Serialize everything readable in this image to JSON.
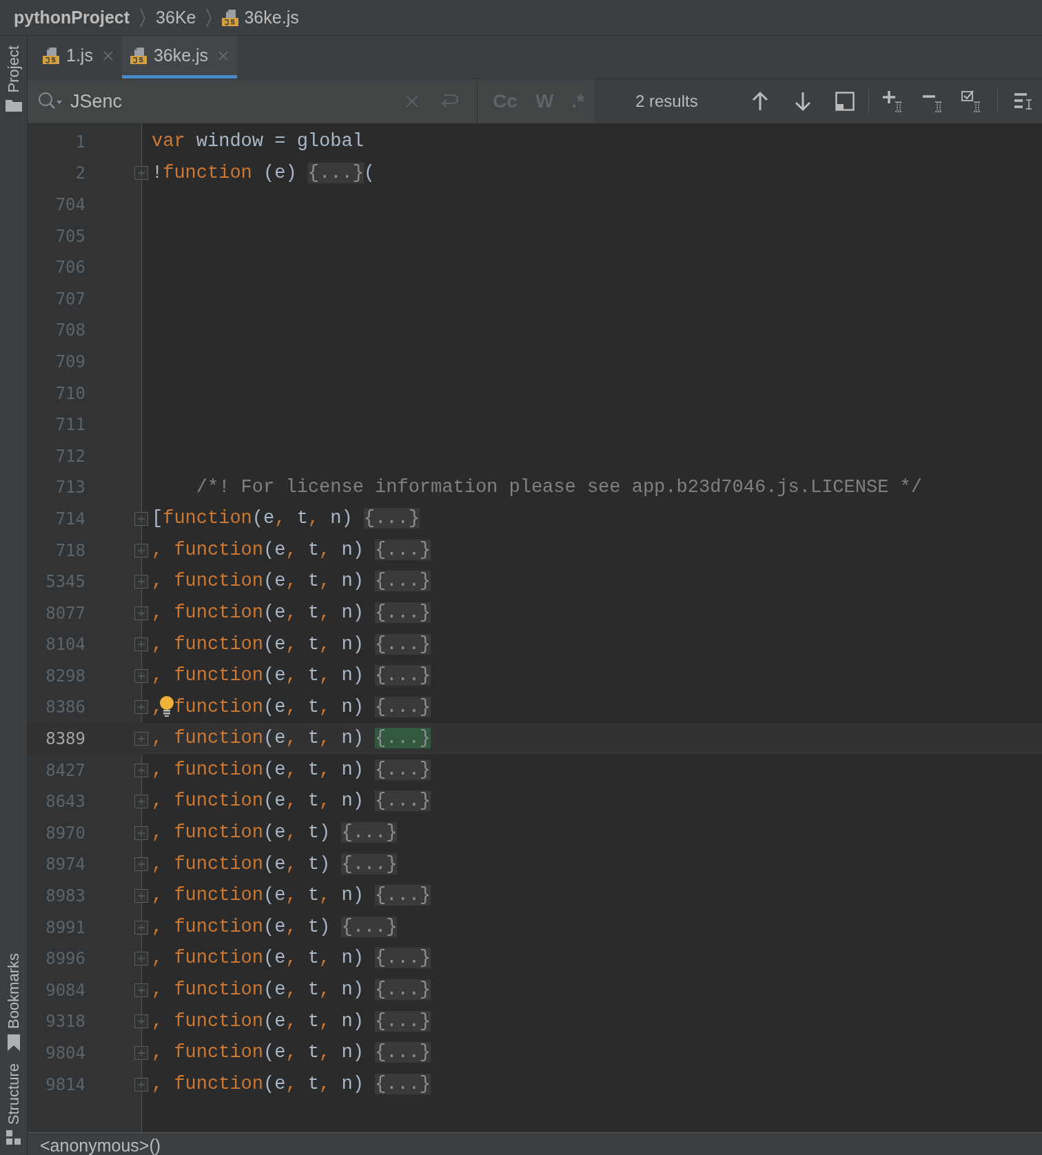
{
  "breadcrumb": [
    {
      "label": "pythonProject",
      "kind": "project"
    },
    {
      "label": "36Ke",
      "kind": "folder"
    },
    {
      "label": "36ke.js",
      "kind": "file"
    }
  ],
  "side_tools": [
    {
      "label": "Project",
      "kind": "folder"
    },
    {
      "label": "Bookmarks",
      "kind": "bookmark"
    },
    {
      "label": "Structure",
      "kind": "structure"
    }
  ],
  "tabs": [
    {
      "label": "1.js",
      "selected": false
    },
    {
      "label": "36ke.js",
      "selected": true
    }
  ],
  "search": {
    "value": "JSenc",
    "options": [
      "Cc",
      "W",
      ".*"
    ],
    "result_count": "2 results"
  },
  "lines": [
    {
      "number": "1",
      "current": false,
      "bulb": false,
      "foldable": false,
      "tokens": [
        {
          "kind": "keyword",
          "text": "var"
        },
        {
          "kind": "plain",
          "text": " window = global"
        }
      ]
    },
    {
      "number": "2",
      "current": false,
      "bulb": false,
      "foldable": true,
      "tokens": [
        {
          "kind": "plain",
          "text": "!"
        },
        {
          "kind": "keyword",
          "text": "function"
        },
        {
          "kind": "plain",
          "text": " (e) "
        },
        {
          "kind": "fold",
          "text": "{...}"
        },
        {
          "kind": "plain",
          "text": "("
        }
      ]
    },
    {
      "number": "704",
      "current": false,
      "bulb": false,
      "foldable": false
    },
    {
      "number": "705",
      "current": false,
      "bulb": false,
      "foldable": false
    },
    {
      "number": "706",
      "current": false,
      "bulb": false,
      "foldable": false
    },
    {
      "number": "707",
      "current": false,
      "bulb": false,
      "foldable": false
    },
    {
      "number": "708",
      "current": false,
      "bulb": false,
      "foldable": false
    },
    {
      "number": "709",
      "current": false,
      "bulb": false,
      "foldable": false
    },
    {
      "number": "710",
      "current": false,
      "bulb": false,
      "foldable": false
    },
    {
      "number": "711",
      "current": false,
      "bulb": false,
      "foldable": false
    },
    {
      "number": "712",
      "current": false,
      "bulb": false,
      "foldable": false
    },
    {
      "number": "713",
      "current": false,
      "bulb": false,
      "foldable": false,
      "tokens": [
        {
          "kind": "comment",
          "text": "    /*! For license information please see app.b23d7046.js.LICENSE */"
        }
      ]
    },
    {
      "number": "714",
      "current": false,
      "bulb": false,
      "foldable": true,
      "tokens": [
        {
          "kind": "plain",
          "text": "["
        },
        {
          "kind": "keyword",
          "text": "function"
        },
        {
          "kind": "plain",
          "text": "(e"
        },
        {
          "kind": "keyword",
          "text": ", "
        },
        {
          "kind": "plain",
          "text": "t"
        },
        {
          "kind": "keyword",
          "text": ", "
        },
        {
          "kind": "plain",
          "text": "n) "
        },
        {
          "kind": "fold",
          "text": "{...}"
        }
      ]
    },
    {
      "number": "718",
      "current": false,
      "bulb": false,
      "foldable": true,
      "tokens": [
        {
          "kind": "keyword",
          "text": ", function"
        },
        {
          "kind": "plain",
          "text": "(e"
        },
        {
          "kind": "keyword",
          "text": ", "
        },
        {
          "kind": "plain",
          "text": "t"
        },
        {
          "kind": "keyword",
          "text": ", "
        },
        {
          "kind": "plain",
          "text": "n) "
        },
        {
          "kind": "fold",
          "text": "{...}"
        }
      ]
    },
    {
      "number": "5345",
      "current": false,
      "bulb": false,
      "foldable": true,
      "tokens": [
        {
          "kind": "keyword",
          "text": ", function"
        },
        {
          "kind": "plain",
          "text": "(e"
        },
        {
          "kind": "keyword",
          "text": ", "
        },
        {
          "kind": "plain",
          "text": "t"
        },
        {
          "kind": "keyword",
          "text": ", "
        },
        {
          "kind": "plain",
          "text": "n) "
        },
        {
          "kind": "fold",
          "text": "{...}"
        }
      ]
    },
    {
      "number": "8077",
      "current": false,
      "bulb": false,
      "foldable": true,
      "tokens": [
        {
          "kind": "keyword",
          "text": ", function"
        },
        {
          "kind": "plain",
          "text": "(e"
        },
        {
          "kind": "keyword",
          "text": ", "
        },
        {
          "kind": "plain",
          "text": "t"
        },
        {
          "kind": "keyword",
          "text": ", "
        },
        {
          "kind": "plain",
          "text": "n) "
        },
        {
          "kind": "fold",
          "text": "{...}"
        }
      ]
    },
    {
      "number": "8104",
      "current": false,
      "bulb": false,
      "foldable": true,
      "tokens": [
        {
          "kind": "keyword",
          "text": ", function"
        },
        {
          "kind": "plain",
          "text": "(e"
        },
        {
          "kind": "keyword",
          "text": ", "
        },
        {
          "kind": "plain",
          "text": "t"
        },
        {
          "kind": "keyword",
          "text": ", "
        },
        {
          "kind": "plain",
          "text": "n) "
        },
        {
          "kind": "fold",
          "text": "{...}"
        }
      ]
    },
    {
      "number": "8298",
      "current": false,
      "bulb": false,
      "foldable": true,
      "tokens": [
        {
          "kind": "keyword",
          "text": ", function"
        },
        {
          "kind": "plain",
          "text": "(e"
        },
        {
          "kind": "keyword",
          "text": ", "
        },
        {
          "kind": "plain",
          "text": "t"
        },
        {
          "kind": "keyword",
          "text": ", "
        },
        {
          "kind": "plain",
          "text": "n) "
        },
        {
          "kind": "fold",
          "text": "{...}"
        }
      ]
    },
    {
      "number": "8386",
      "current": false,
      "bulb": true,
      "foldable": true,
      "tokens": [
        {
          "kind": "keyword",
          "text": ", function"
        },
        {
          "kind": "plain",
          "text": "(e"
        },
        {
          "kind": "keyword",
          "text": ", "
        },
        {
          "kind": "plain",
          "text": "t"
        },
        {
          "kind": "keyword",
          "text": ", "
        },
        {
          "kind": "plain",
          "text": "n) "
        },
        {
          "kind": "fold",
          "text": "{...}"
        }
      ]
    },
    {
      "number": "8389",
      "current": true,
      "bulb": false,
      "foldable": true,
      "tokens": [
        {
          "kind": "keyword",
          "text": ", function"
        },
        {
          "kind": "plain",
          "text": "(e"
        },
        {
          "kind": "keyword",
          "text": ", "
        },
        {
          "kind": "plain",
          "text": "t"
        },
        {
          "kind": "keyword",
          "text": ", "
        },
        {
          "kind": "plain",
          "text": "n) "
        },
        {
          "kind": "fold_match",
          "text": "{...}"
        }
      ]
    },
    {
      "number": "8427",
      "current": false,
      "bulb": false,
      "foldable": true,
      "tokens": [
        {
          "kind": "keyword",
          "text": ", function"
        },
        {
          "kind": "plain",
          "text": "(e"
        },
        {
          "kind": "keyword",
          "text": ", "
        },
        {
          "kind": "plain",
          "text": "t"
        },
        {
          "kind": "keyword",
          "text": ", "
        },
        {
          "kind": "plain",
          "text": "n) "
        },
        {
          "kind": "fold",
          "text": "{...}"
        }
      ]
    },
    {
      "number": "8643",
      "current": false,
      "bulb": false,
      "foldable": true,
      "tokens": [
        {
          "kind": "keyword",
          "text": ", function"
        },
        {
          "kind": "plain",
          "text": "(e"
        },
        {
          "kind": "keyword",
          "text": ", "
        },
        {
          "kind": "plain",
          "text": "t"
        },
        {
          "kind": "keyword",
          "text": ", "
        },
        {
          "kind": "plain",
          "text": "n) "
        },
        {
          "kind": "fold",
          "text": "{...}"
        }
      ]
    },
    {
      "number": "8970",
      "current": false,
      "bulb": false,
      "foldable": true,
      "tokens": [
        {
          "kind": "keyword",
          "text": ", function"
        },
        {
          "kind": "plain",
          "text": "(e"
        },
        {
          "kind": "keyword",
          "text": ", "
        },
        {
          "kind": "plain",
          "text": "t) "
        },
        {
          "kind": "fold",
          "text": "{...}"
        }
      ]
    },
    {
      "number": "8974",
      "current": false,
      "bulb": false,
      "foldable": true,
      "tokens": [
        {
          "kind": "keyword",
          "text": ", function"
        },
        {
          "kind": "plain",
          "text": "(e"
        },
        {
          "kind": "keyword",
          "text": ", "
        },
        {
          "kind": "plain",
          "text": "t) "
        },
        {
          "kind": "fold",
          "text": "{...}"
        }
      ]
    },
    {
      "number": "8983",
      "current": false,
      "bulb": false,
      "foldable": true,
      "tokens": [
        {
          "kind": "keyword",
          "text": ", function"
        },
        {
          "kind": "plain",
          "text": "(e"
        },
        {
          "kind": "keyword",
          "text": ", "
        },
        {
          "kind": "plain",
          "text": "t"
        },
        {
          "kind": "keyword",
          "text": ", "
        },
        {
          "kind": "plain",
          "text": "n) "
        },
        {
          "kind": "fold",
          "text": "{...}"
        }
      ]
    },
    {
      "number": "8991",
      "current": false,
      "bulb": false,
      "foldable": true,
      "tokens": [
        {
          "kind": "keyword",
          "text": ", function"
        },
        {
          "kind": "plain",
          "text": "(e"
        },
        {
          "kind": "keyword",
          "text": ", "
        },
        {
          "kind": "plain",
          "text": "t) "
        },
        {
          "kind": "fold",
          "text": "{...}"
        }
      ]
    },
    {
      "number": "8996",
      "current": false,
      "bulb": false,
      "foldable": true,
      "tokens": [
        {
          "kind": "keyword",
          "text": ", function"
        },
        {
          "kind": "plain",
          "text": "(e"
        },
        {
          "kind": "keyword",
          "text": ", "
        },
        {
          "kind": "plain",
          "text": "t"
        },
        {
          "kind": "keyword",
          "text": ", "
        },
        {
          "kind": "plain",
          "text": "n) "
        },
        {
          "kind": "fold",
          "text": "{...}"
        }
      ]
    },
    {
      "number": "9084",
      "current": false,
      "bulb": false,
      "foldable": true,
      "tokens": [
        {
          "kind": "keyword",
          "text": ", function"
        },
        {
          "kind": "plain",
          "text": "(e"
        },
        {
          "kind": "keyword",
          "text": ", "
        },
        {
          "kind": "plain",
          "text": "t"
        },
        {
          "kind": "keyword",
          "text": ", "
        },
        {
          "kind": "plain",
          "text": "n) "
        },
        {
          "kind": "fold",
          "text": "{...}"
        }
      ]
    },
    {
      "number": "9318",
      "current": false,
      "bulb": false,
      "foldable": true,
      "tokens": [
        {
          "kind": "keyword",
          "text": ", function"
        },
        {
          "kind": "plain",
          "text": "(e"
        },
        {
          "kind": "keyword",
          "text": ", "
        },
        {
          "kind": "plain",
          "text": "t"
        },
        {
          "kind": "keyword",
          "text": ", "
        },
        {
          "kind": "plain",
          "text": "n) "
        },
        {
          "kind": "fold",
          "text": "{...}"
        }
      ]
    },
    {
      "number": "9804",
      "current": false,
      "bulb": false,
      "foldable": true,
      "tokens": [
        {
          "kind": "keyword",
          "text": ", function"
        },
        {
          "kind": "plain",
          "text": "(e"
        },
        {
          "kind": "keyword",
          "text": ", "
        },
        {
          "kind": "plain",
          "text": "t"
        },
        {
          "kind": "keyword",
          "text": ", "
        },
        {
          "kind": "plain",
          "text": "n) "
        },
        {
          "kind": "fold",
          "text": "{...}"
        }
      ]
    },
    {
      "number": "9814",
      "current": false,
      "bulb": false,
      "foldable": true,
      "tokens": [
        {
          "kind": "keyword",
          "text": ", function"
        },
        {
          "kind": "plain",
          "text": "(e"
        },
        {
          "kind": "keyword",
          "text": ", "
        },
        {
          "kind": "plain",
          "text": "t"
        },
        {
          "kind": "keyword",
          "text": ", "
        },
        {
          "kind": "plain",
          "text": "n) "
        },
        {
          "kind": "fold",
          "text": "{...}"
        }
      ]
    }
  ],
  "status_bar": {
    "text": "<anonymous>()"
  }
}
